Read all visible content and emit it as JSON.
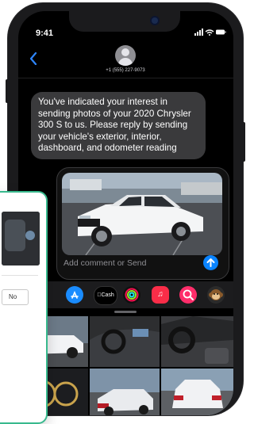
{
  "status_bar": {
    "time": "9:41",
    "signal_wifi_battery": "••• ▲ ▬"
  },
  "header": {
    "contact_number": "+1 (555) 227-9073",
    "back_icon": "chevron-left-icon",
    "avatar_icon": "person-icon"
  },
  "message": {
    "text": "You've indicated your interest in sending photos of your 2020 Chrysler 300 S to us. Please reply by sending your vehicle's exterior, interior, dashboard, and odometer reading"
  },
  "compose": {
    "placeholder": "Add comment or Send",
    "send_icon": "arrow-up-icon"
  },
  "app_strip": {
    "apps": [
      {
        "name": "photos-icon",
        "color": "#ffffff"
      },
      {
        "name": "app-store-icon",
        "label": "A",
        "color": "#1a8cff"
      },
      {
        "name": "apple-cash-icon",
        "label": "Cash",
        "color": "#000000"
      },
      {
        "name": "activity-icon",
        "color": "#111111"
      },
      {
        "name": "music-icon",
        "label": "♫",
        "color": "#fa2d48"
      },
      {
        "name": "image-search-icon",
        "color": "#ff2d6a"
      },
      {
        "name": "animoji-icon",
        "color": "#2b2b2b"
      }
    ]
  },
  "photo_card": {
    "no_label": "No"
  },
  "colors": {
    "accent": "#0a84ff",
    "card_border": "#38b98d"
  }
}
